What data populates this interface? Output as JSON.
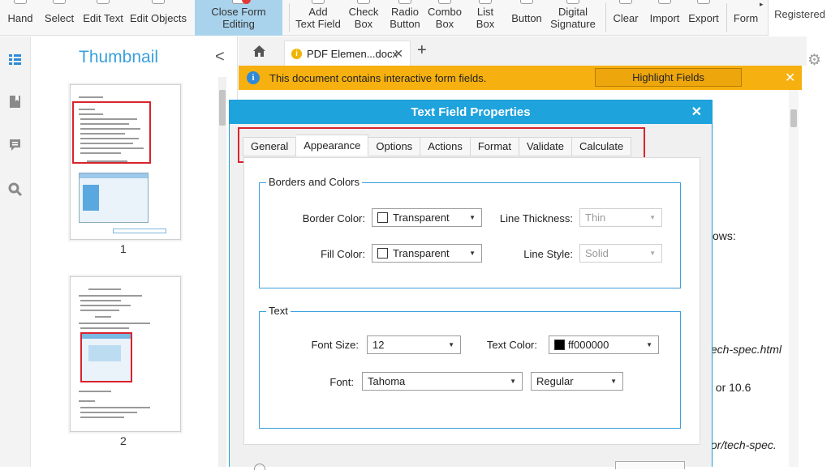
{
  "ribbon": {
    "items": [
      {
        "label": "Hand"
      },
      {
        "label": "Select"
      },
      {
        "label": "Edit Text"
      },
      {
        "label": "Edit Objects"
      },
      {
        "label": "Close Form Editing"
      },
      {
        "label": "Add\nText Field"
      },
      {
        "label": "Check\nBox"
      },
      {
        "label": "Radio\nButton"
      },
      {
        "label": "Combo\nBox"
      },
      {
        "label": "List\nBox"
      },
      {
        "label": "Button"
      },
      {
        "label": "Digital\nSignature"
      },
      {
        "label": "Clear"
      },
      {
        "label": "Import"
      },
      {
        "label": "Export"
      },
      {
        "label": "Form"
      }
    ],
    "registered": "Registered",
    "accent_color": "#a9d3ec"
  },
  "thumbnails": {
    "title": "Thumbnail",
    "pages": [
      "1",
      "2"
    ],
    "selection_color": "#d9232d"
  },
  "tabs": {
    "document_tab": "PDF Elemen...docx"
  },
  "infobar": {
    "message": "This document contains interactive form fields.",
    "button": "Highlight Fields",
    "color": "#f6b00f"
  },
  "document": {
    "fragments": [
      "ows:",
      "tech-spec.html",
      ", or 10.6",
      "tor/tech-spec."
    ]
  },
  "dialog": {
    "title": "Text Field Properties",
    "tabs": [
      "General",
      "Appearance",
      "Options",
      "Actions",
      "Format",
      "Validate",
      "Calculate"
    ],
    "active_tab": "Appearance",
    "borders_group": {
      "title": "Borders and Colors",
      "border_color_label": "Border Color:",
      "border_color_value": "Transparent",
      "fill_color_label": "Fill Color:",
      "fill_color_value": "Transparent",
      "line_thickness_label": "Line Thickness:",
      "line_thickness_value": "Thin",
      "line_style_label": "Line Style:",
      "line_style_value": "Solid"
    },
    "text_group": {
      "title": "Text",
      "font_size_label": "Font Size:",
      "font_size_value": "12",
      "text_color_label": "Text Color:",
      "text_color_value": "ff000000",
      "font_label": "Font:",
      "font_value": "Tahoma",
      "font_style_value": "Regular"
    },
    "title_color": "#1fa3dd",
    "highlight_color": "#d9232d"
  }
}
